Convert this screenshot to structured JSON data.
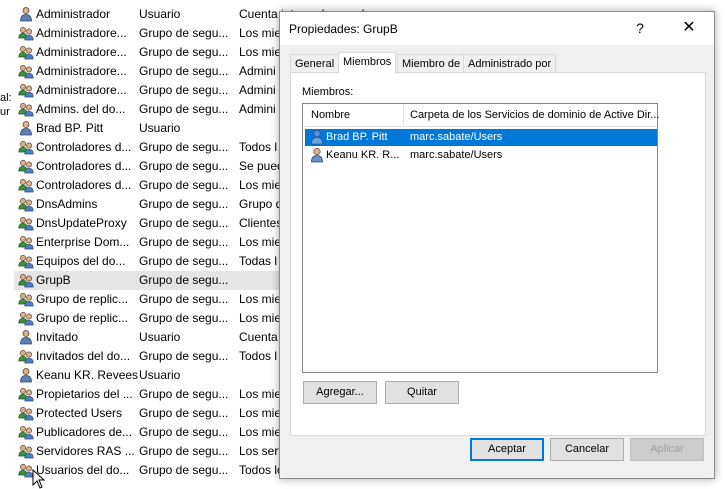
{
  "background_list": {
    "edge_fragments": [
      "al:",
      "ur"
    ],
    "rows": [
      {
        "name": "Administrador",
        "type": "Usuario",
        "description": "Cuenta integrada para la",
        "icon": "user-icon",
        "selected": false
      },
      {
        "name": "Administradore...",
        "type": "Grupo de segu...",
        "description": "Los mie",
        "icon": "group-icon",
        "selected": false
      },
      {
        "name": "Administradore...",
        "type": "Grupo de segu...",
        "description": "Los mie",
        "icon": "group-icon",
        "selected": false
      },
      {
        "name": "Administradore...",
        "type": "Grupo de segu...",
        "description": "Admini",
        "icon": "group-icon",
        "selected": false
      },
      {
        "name": "Administradore...",
        "type": "Grupo de segu...",
        "description": "Admini",
        "icon": "group-icon",
        "selected": false
      },
      {
        "name": "Admins. del do...",
        "type": "Grupo de segu...",
        "description": "Admini",
        "icon": "group-icon",
        "selected": false
      },
      {
        "name": "Brad BP. Pitt",
        "type": "Usuario",
        "description": "",
        "icon": "user-icon",
        "selected": false
      },
      {
        "name": "Controladores d...",
        "type": "Grupo de segu...",
        "description": "Todos l",
        "icon": "group-icon",
        "selected": false
      },
      {
        "name": "Controladores d...",
        "type": "Grupo de segu...",
        "description": "Se pued",
        "icon": "group-icon",
        "selected": false
      },
      {
        "name": "Controladores d...",
        "type": "Grupo de segu...",
        "description": "Los mie",
        "icon": "group-icon",
        "selected": false
      },
      {
        "name": "DnsAdmins",
        "type": "Grupo de segu...",
        "description": "Grupo d",
        "icon": "group-icon",
        "selected": false
      },
      {
        "name": "DnsUpdateProxy",
        "type": "Grupo de segu...",
        "description": "Clientes",
        "icon": "group-icon",
        "selected": false
      },
      {
        "name": "Enterprise Dom...",
        "type": "Grupo de segu...",
        "description": "Los mie",
        "icon": "group-icon",
        "selected": false
      },
      {
        "name": "Equipos del do...",
        "type": "Grupo de segu...",
        "description": "Todas l",
        "icon": "group-icon",
        "selected": false
      },
      {
        "name": "GrupB",
        "type": "Grupo de segu...",
        "description": "",
        "icon": "group-icon",
        "selected": true
      },
      {
        "name": "Grupo de replic...",
        "type": "Grupo de segu...",
        "description": "Los mie",
        "icon": "group-icon",
        "selected": false
      },
      {
        "name": "Grupo de replic...",
        "type": "Grupo de segu...",
        "description": "Los mie",
        "icon": "group-icon",
        "selected": false
      },
      {
        "name": "Invitado",
        "type": "Usuario",
        "description": "Cuenta",
        "icon": "user-icon",
        "selected": false
      },
      {
        "name": "Invitados del do...",
        "type": "Grupo de segu...",
        "description": "Todos l",
        "icon": "group-icon",
        "selected": false
      },
      {
        "name": "Keanu KR. Revees",
        "type": "Usuario",
        "description": "",
        "icon": "user-icon",
        "selected": false
      },
      {
        "name": "Propietarios del ...",
        "type": "Grupo de segu...",
        "description": "Los mie",
        "icon": "group-icon",
        "selected": false
      },
      {
        "name": "Protected Users",
        "type": "Grupo de segu...",
        "description": "Los mie",
        "icon": "group-icon",
        "selected": false
      },
      {
        "name": "Publicadores de...",
        "type": "Grupo de segu...",
        "description": "Los mie",
        "icon": "group-icon",
        "selected": false
      },
      {
        "name": "Servidores RAS ...",
        "type": "Grupo de segu...",
        "description": "Los serv",
        "icon": "group-icon",
        "selected": false
      },
      {
        "name": "Usuarios del do...",
        "type": "Grupo de segu...",
        "description": "Todos los usuarios del d",
        "icon": "group-icon",
        "selected": false
      }
    ]
  },
  "dialog": {
    "title": "Propiedades: GrupB",
    "help_label": "?",
    "close_label": "✕",
    "tabs": [
      {
        "label": "General",
        "active": false
      },
      {
        "label": "Miembros",
        "active": true
      },
      {
        "label": "Miembro de",
        "active": false
      },
      {
        "label": "Administrado por",
        "active": false
      }
    ],
    "members_label": "Miembros:",
    "columns": {
      "name": "Nombre",
      "folder": "Carpeta de los Servicios de dominio de Active Dir..."
    },
    "members": [
      {
        "name": "Brad BP. Pitt",
        "folder": "marc.sabate/Users",
        "selected": true
      },
      {
        "name": "Keanu KR. R...",
        "folder": "marc.sabate/Users",
        "selected": false
      }
    ],
    "add_label": "Agregar...",
    "remove_label": "Quitar",
    "ok_label": "Aceptar",
    "cancel_label": "Cancelar",
    "apply_label": "Aplicar"
  },
  "colors": {
    "selection": "#0078d7",
    "row_selected": "#e5e5e5",
    "dialog_bg": "#f0f0f0"
  }
}
